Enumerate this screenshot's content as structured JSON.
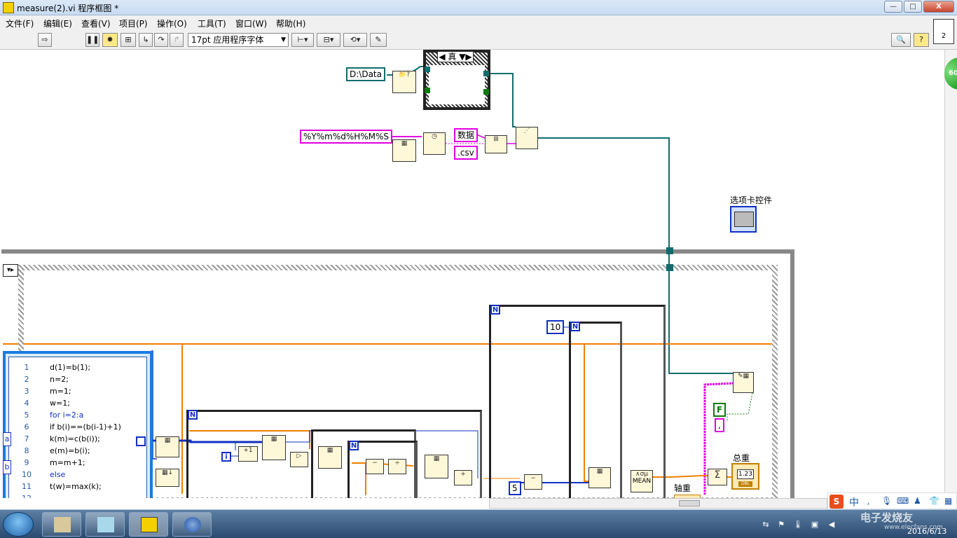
{
  "window": {
    "title": "measure(2).vi 程序框图 *",
    "buttons": {
      "minimize": "—",
      "maximize": "□",
      "close": "X"
    }
  },
  "menu": [
    "文件(F)",
    "编辑(E)",
    "查看(V)",
    "项目(P)",
    "操作(O)",
    "工具(T)",
    "窗口(W)",
    "帮助(H)"
  ],
  "toolbar": {
    "font": "17pt 应用程序字体",
    "corner_badge": "2"
  },
  "side_badge": "60",
  "diagram": {
    "case_selector": "真",
    "path_constant": "D:\\Data",
    "format_string": "%Y%m%d%H%M%S",
    "name_constant": "数据",
    "ext_constant": ".csv",
    "tab_control_label": "选项卡控件",
    "total_weight_label": "总重",
    "axle_weight_label": "轴重",
    "mean_label": "MEAN",
    "numeric_10": "10",
    "numeric_5": "5",
    "loop_count_label": "N",
    "iteration_label": "i",
    "bool_constant": "F",
    "comma_constant": ",",
    "indicator_value": "1.23",
    "indicator_type": "DBL",
    "formula_inputs": [
      "a",
      "b"
    ],
    "formula_lines": [
      "d(1)=b(1);",
      "n=2;",
      "m=1;",
      "w=1;",
      "for i=2:a",
      "if b(i)==(b(i-1)+1)",
      "k(m)=c(b(i));",
      "e(m)=b(i);",
      "m=m+1;",
      "else",
      "t(w)=max(k);",
      ""
    ],
    "line_numbers": [
      "1",
      "2",
      "3",
      "4",
      "5",
      "6",
      "7",
      "8",
      "9",
      "10",
      "11",
      "12"
    ]
  },
  "taskbar": {
    "date": "2016/6/13",
    "watermark": "电子发烧友",
    "watermark_sub": "www.elecfans.com"
  },
  "ime": {
    "label": "中"
  },
  "colors": {
    "path_wire": "#0f6d6d",
    "string_wire": "#e000e0",
    "numeric_wire": "#1030c0",
    "dbl_wire": "#f08000"
  }
}
